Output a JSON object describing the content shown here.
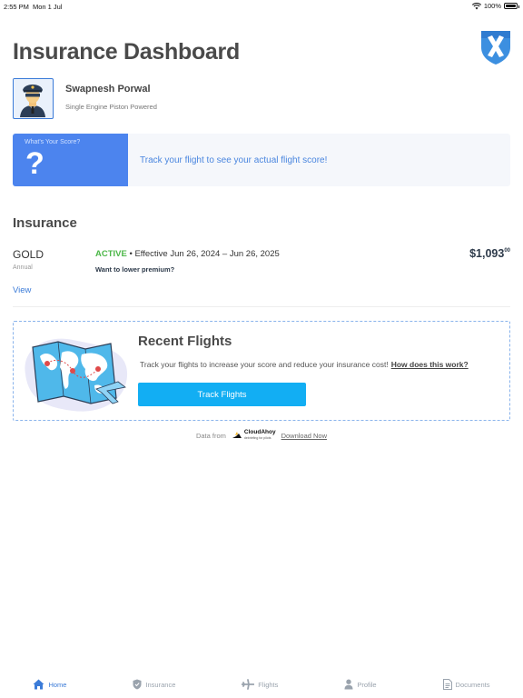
{
  "status_bar": {
    "time": "2:55 PM",
    "date": "Mon 1 Jul",
    "battery": "100%"
  },
  "header": {
    "title": "Insurance Dashboard"
  },
  "profile": {
    "name": "Swapnesh Porwal",
    "subtitle": "Single Engine Piston Powered"
  },
  "score": {
    "label": "What's Your Score?",
    "value": "?",
    "message": "Track your flight to see your actual flight score!"
  },
  "insurance": {
    "section_title": "Insurance",
    "plan": "GOLD",
    "term": "Annual",
    "status": "ACTIVE",
    "effective": "• Effective Jun 26, 2024 – Jun 26, 2025",
    "lower_premium": "Want to lower premium?",
    "price_main": "$1,093",
    "price_cents": "00",
    "view_label": "View"
  },
  "recent_flights": {
    "title": "Recent Flights",
    "description": "Track your flights to increase your score and reduce your insurance cost!",
    "how_link": "How does this work?",
    "button": "Track Flights"
  },
  "data_source": {
    "prefix": "Data from",
    "brand": "CloudAhoy",
    "brand_tag": "debriefing for pilots",
    "download": "Download Now"
  },
  "tabs": [
    {
      "label": "Home",
      "icon": "home-icon",
      "active": true
    },
    {
      "label": "Insurance",
      "icon": "shield-icon",
      "active": false
    },
    {
      "label": "Flights",
      "icon": "airplane-icon",
      "active": false
    },
    {
      "label": "Profile",
      "icon": "person-icon",
      "active": false
    },
    {
      "label": "Documents",
      "icon": "document-icon",
      "active": false
    }
  ],
  "colors": {
    "accent": "#3b7bd8",
    "score_bg": "#4c84ee",
    "active": "#4cb748",
    "button": "#12aef3"
  }
}
